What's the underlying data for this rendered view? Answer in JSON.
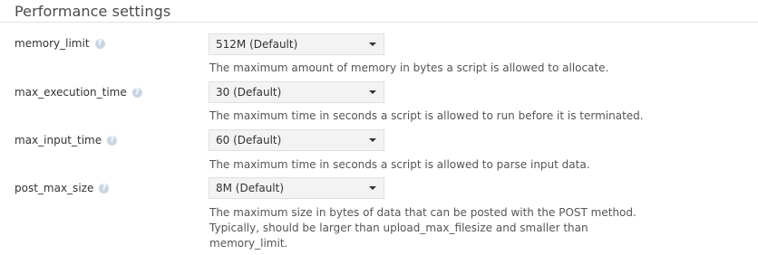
{
  "section": {
    "title": "Performance settings"
  },
  "settings": [
    {
      "name": "memory_limit",
      "value": "512M (Default)",
      "description": "The maximum amount of memory in bytes a script is allowed to allocate."
    },
    {
      "name": "max_execution_time",
      "value": "30 (Default)",
      "description": "The maximum time in seconds a script is allowed to run before it is terminated."
    },
    {
      "name": "max_input_time",
      "value": "60 (Default)",
      "description": "The maximum time in seconds a script is allowed to parse input data."
    },
    {
      "name": "post_max_size",
      "value": "8M (Default)",
      "description": "The maximum size in bytes of data that can be posted with the POST method. Typically, should be larger than upload_max_filesize and smaller than memory_limit."
    }
  ],
  "icons": {
    "help": "question-mark-icon",
    "dropdown": "chevron-down-icon"
  },
  "colors": {
    "help_badge": "#c9d6e2",
    "select_bg": "#f3f3f3",
    "rule": "#e2e2e2"
  }
}
